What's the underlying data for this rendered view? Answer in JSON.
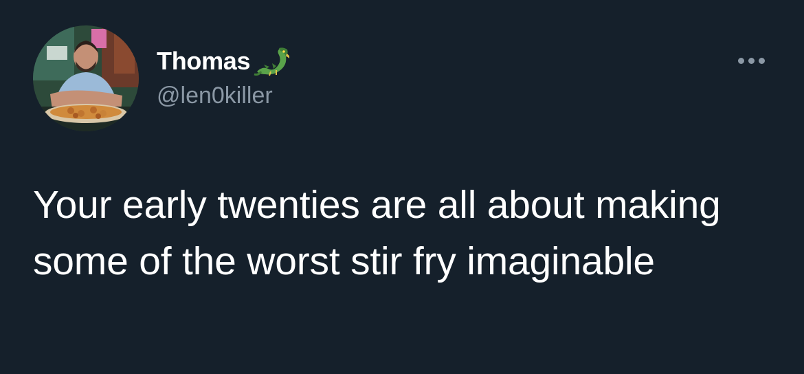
{
  "tweet": {
    "display_name": "Thomas",
    "handle": "@len0killer",
    "text": "Your early twenties are all about making some of the worst stir fry imaginable"
  },
  "icons": {
    "avatar": "profile-photo",
    "name_emoji": "dragon-icon",
    "more": "more-options-icon"
  },
  "colors": {
    "background": "#15202b",
    "primary_text": "#ffffff",
    "secondary_text": "#8b98a5"
  }
}
